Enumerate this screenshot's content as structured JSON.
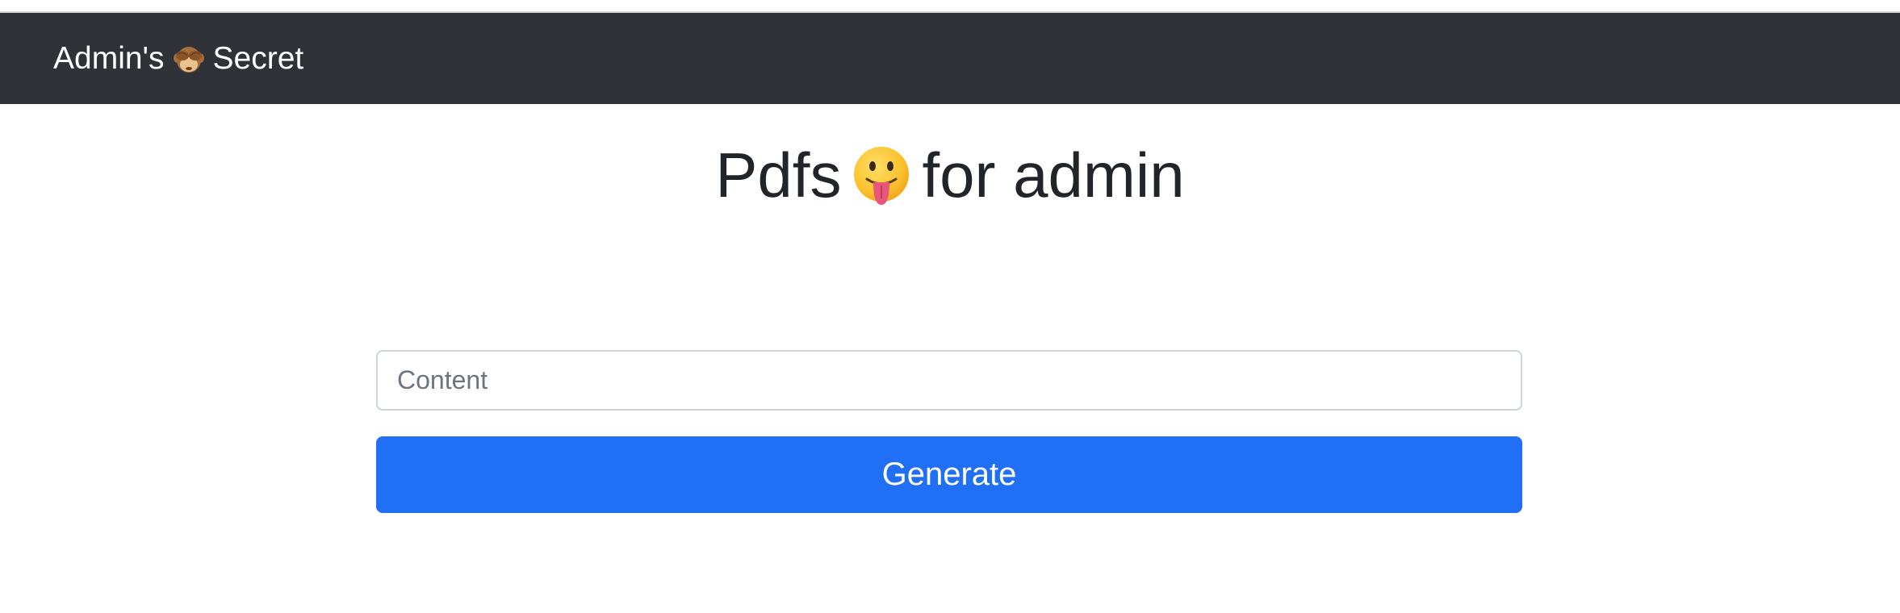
{
  "navbar": {
    "brand_prefix": "Admin's",
    "brand_icon": "see-no-evil-monkey-icon",
    "brand_suffix": "Secret"
  },
  "main": {
    "title_prefix": "Pdfs",
    "title_icon": "tongue-out-face-icon",
    "title_suffix": "for admin"
  },
  "form": {
    "content_placeholder": "Content",
    "content_value": "",
    "generate_label": "Generate"
  },
  "colors": {
    "navbar_bg": "#2f3338",
    "primary_button": "#216ff5",
    "title_text": "#212529"
  }
}
